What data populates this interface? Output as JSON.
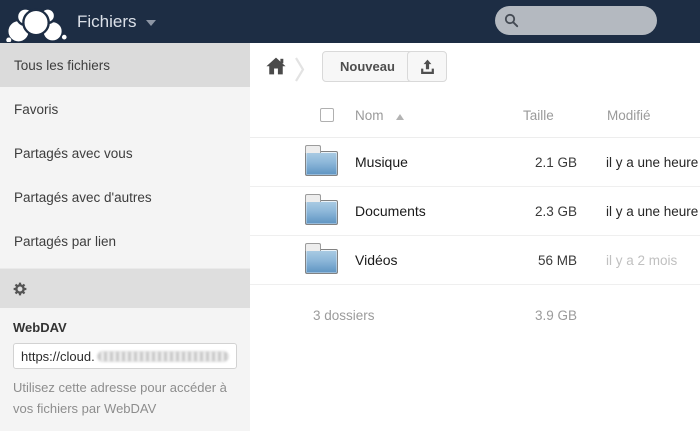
{
  "app": {
    "title": "Fichiers"
  },
  "colors": {
    "header_bg": "#1d2d44",
    "folder_blue": "#5e94c2",
    "active_item_bg": "#dbdbdb"
  },
  "search": {
    "value": "",
    "placeholder": ""
  },
  "sidebar": {
    "items": [
      {
        "label": "Tous les fichiers",
        "active": true
      },
      {
        "label": "Favoris",
        "active": false
      },
      {
        "label": "Partagés avec vous",
        "active": false
      },
      {
        "label": "Partagés avec d'autres",
        "active": false
      },
      {
        "label": "Partagés par lien",
        "active": false
      }
    ],
    "webdav": {
      "label": "WebDAV",
      "url_visible_prefix": "https://cloud.",
      "url_redacted": true,
      "help": "Utilisez cette adresse pour accéder à vos fichiers par WebDAV"
    }
  },
  "toolbar": {
    "new_button": "Nouveau"
  },
  "file_list": {
    "columns": {
      "name": "Nom",
      "size": "Taille",
      "modified": "Modifié"
    },
    "sort": {
      "column": "name",
      "direction": "ascending"
    },
    "rows": [
      {
        "name": "Musique",
        "size": "2.1 GB",
        "modified": "il y a une heure"
      },
      {
        "name": "Documents",
        "size": "2.3 GB",
        "modified": "il y a une heure"
      },
      {
        "name": "Vidéos",
        "size": "56 MB",
        "modified": "il y a 2 mois"
      }
    ],
    "summary": {
      "folders": "3 dossiers",
      "size": "3.9 GB"
    }
  }
}
